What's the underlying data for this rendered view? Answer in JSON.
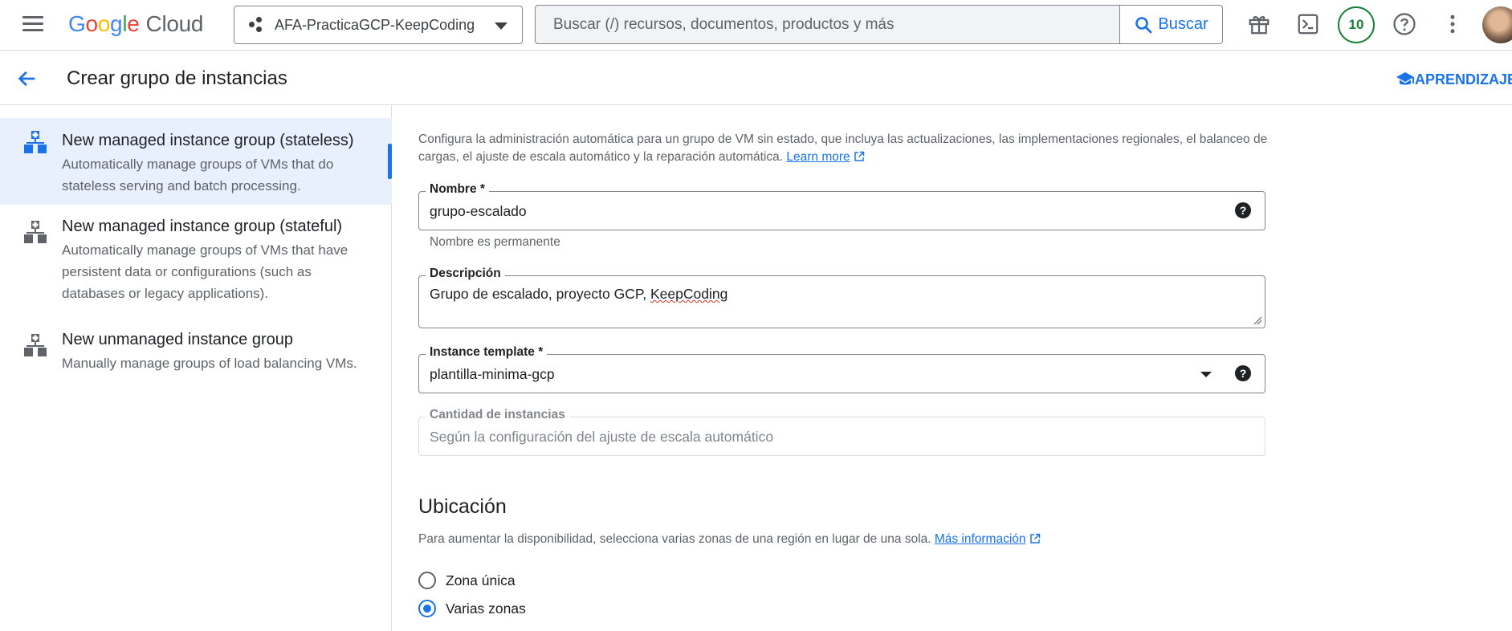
{
  "topbar": {
    "logo_letters": [
      "G",
      "o",
      "o",
      "g",
      "l",
      "e"
    ],
    "logo_suffix": "Cloud",
    "project_name": "AFA-PracticaGCP-KeepCoding",
    "search_placeholder": "Buscar (/) recursos, documentos, productos y más",
    "search_button": "Buscar",
    "notification_count": "10",
    "icons": [
      "menu-icon",
      "gift-icon",
      "cloud-shell-icon",
      "help-icon",
      "more-vert-icon"
    ]
  },
  "header": {
    "title": "Crear grupo de instancias",
    "learning_button": "APRENDIZAJE"
  },
  "sidebar": {
    "options": [
      {
        "title": "New managed instance group (stateless)",
        "description": "Automatically manage groups of VMs that do stateless serving and batch processing.",
        "selected": true
      },
      {
        "title": "New managed instance group (stateful)",
        "description": "Automatically manage groups of VMs that have persistent data or configurations (such as databases or legacy applications).",
        "selected": false
      },
      {
        "title": "New unmanaged instance group",
        "description": "Manually manage groups of load balancing VMs.",
        "selected": false
      }
    ]
  },
  "form": {
    "intro_text": "Configura la administración automática para un grupo de VM sin estado, que incluya las actualizaciones, las implementaciones regionales, el balanceo de cargas, el ajuste de escala automático y la reparación automática.",
    "intro_link": "Learn more",
    "name_label": "Nombre *",
    "name_value": "grupo-escalado",
    "name_hint": "Nombre es permanente",
    "description_label": "Descripción",
    "description_value_prefix": "Grupo de escalado, proyecto GCP, ",
    "description_value_flagged": "KeepCoding",
    "template_label": "Instance template *",
    "template_value": "plantilla-minima-gcp",
    "instances_label": "Cantidad de instancias",
    "instances_value": "Según la configuración del ajuste de escala automático",
    "help_glyph": "?"
  },
  "location": {
    "heading": "Ubicación",
    "description": "Para aumentar la disponibilidad, selecciona varias zonas de una región en lugar de una sola.",
    "link": "Más información",
    "options": [
      {
        "label": "Zona única",
        "selected": false
      },
      {
        "label": "Varias zonas",
        "selected": true
      }
    ]
  },
  "colors": {
    "accent": "#1a73e8",
    "selected_bg": "#e8f0fe",
    "badge": "#188038"
  }
}
